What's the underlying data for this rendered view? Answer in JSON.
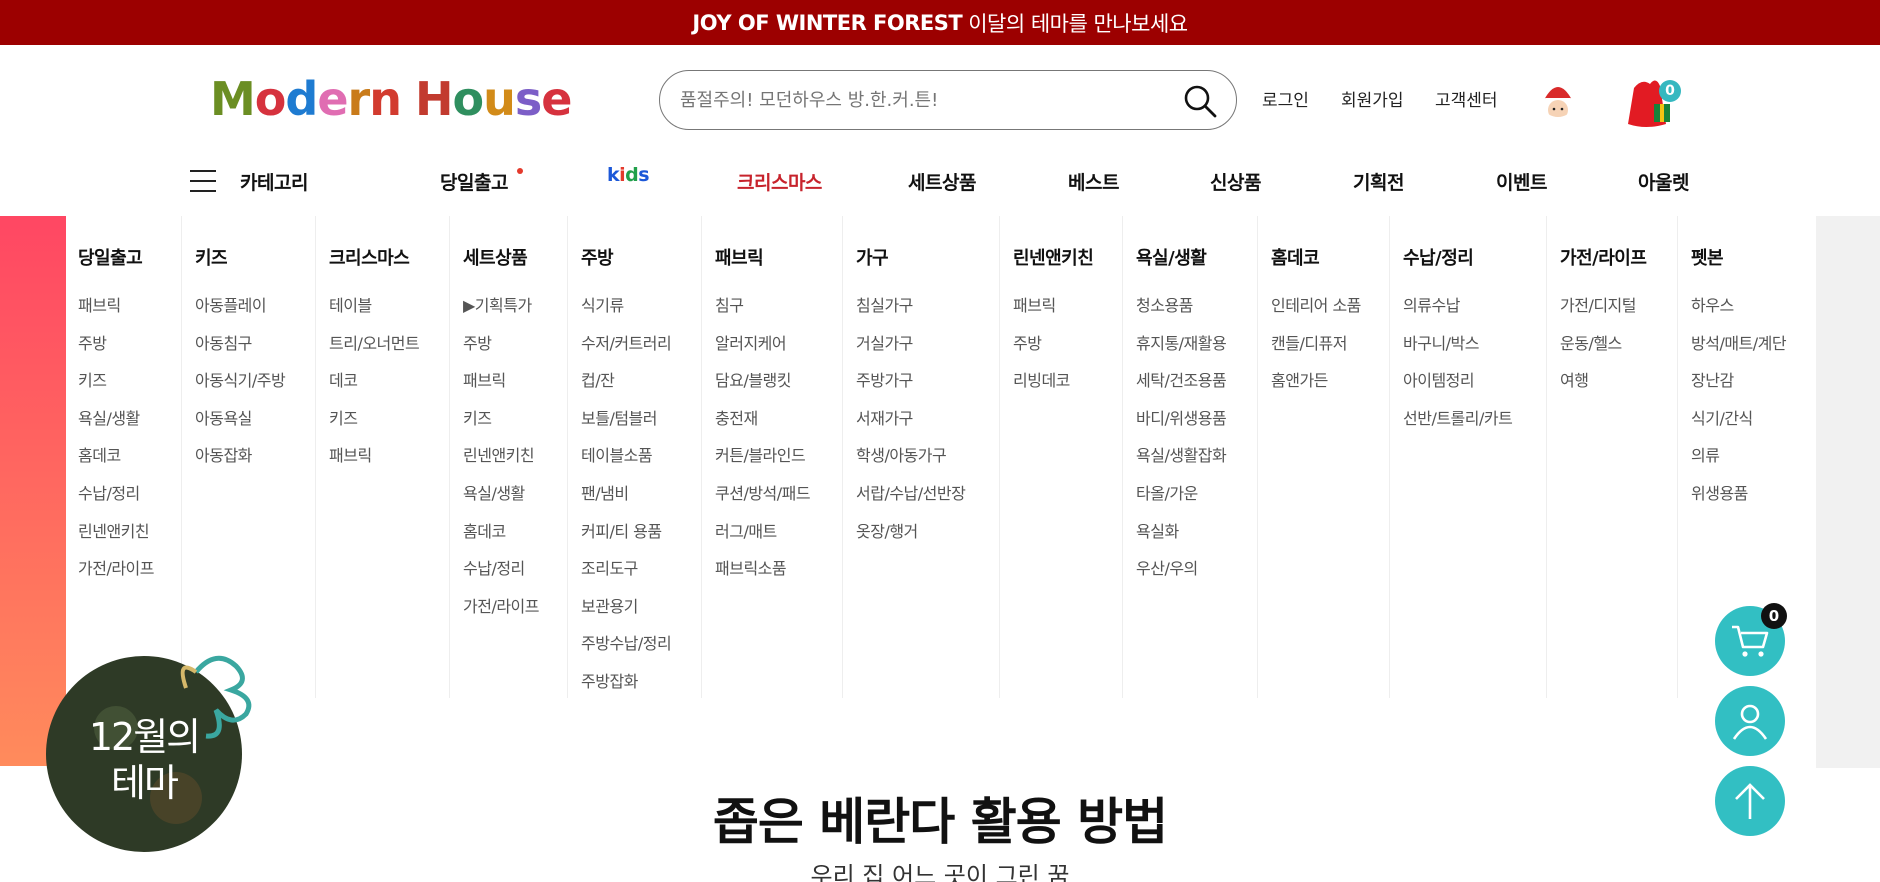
{
  "top_banner": {
    "bold": "JOY OF WINTER FOREST",
    "text": "이달의 테마를 만나보세요"
  },
  "logo": {
    "text": "ModernHouse"
  },
  "search": {
    "placeholder": "품절주의! 모던하우스 방.한.커.튼!"
  },
  "header_links": {
    "login": "로그인",
    "signup": "회원가입",
    "support": "고객센터"
  },
  "cart_count": "0",
  "nav": {
    "category": "카테고리",
    "same_day": "당일출고",
    "kids": "kids",
    "christmas": "크리스마스",
    "set": "세트상품",
    "best": "베스트",
    "new": "신상품",
    "promotion": "기획전",
    "event": "이벤트",
    "outlet": "아울렛"
  },
  "mega_menu": [
    {
      "title": "당일출고",
      "items": [
        "패브릭",
        "주방",
        "키즈",
        "욕실/생활",
        "홈데코",
        "수납/정리",
        "린넨앤키친",
        "가전/라이프"
      ]
    },
    {
      "title": "키즈",
      "items": [
        "아동플레이",
        "아동침구",
        "아동식기/주방",
        "아동욕실",
        "아동잡화"
      ]
    },
    {
      "title": "크리스마스",
      "items": [
        "테이블",
        "트리/오너먼트",
        "데코",
        "키즈",
        "패브릭"
      ]
    },
    {
      "title": "세트상품",
      "items": [
        "▶기획특가",
        "주방",
        "패브릭",
        "키즈",
        "린넨앤키친",
        "욕실/생활",
        "홈데코",
        "수납/정리",
        "가전/라이프"
      ]
    },
    {
      "title": "주방",
      "items": [
        "식기류",
        "수저/커트러리",
        "컵/잔",
        "보틀/텀블러",
        "테이블소품",
        "팬/냄비",
        "커피/티 용품",
        "조리도구",
        "보관용기",
        "주방수납/정리",
        "주방잡화"
      ]
    },
    {
      "title": "패브릭",
      "items": [
        "침구",
        "알러지케어",
        "담요/블랭킷",
        "충전재",
        "커튼/블라인드",
        "쿠션/방석/패드",
        "러그/매트",
        "패브릭소품"
      ]
    },
    {
      "title": "가구",
      "items": [
        "침실가구",
        "거실가구",
        "주방가구",
        "서재가구",
        "학생/아동가구",
        "서랍/수납/선반장",
        "옷장/행거"
      ]
    },
    {
      "title": "린넨앤키친",
      "items": [
        "패브릭",
        "주방",
        "리빙데코"
      ]
    },
    {
      "title": "욕실/생활",
      "items": [
        "청소용품",
        "휴지통/재활용",
        "세탁/건조용품",
        "바디/위생용품",
        "욕실/생활잡화",
        "타올/가운",
        "욕실화",
        "우산/우의"
      ]
    },
    {
      "title": "홈데코",
      "items": [
        "인테리어 소품",
        "캔들/디퓨저",
        "홈앤가든"
      ]
    },
    {
      "title": "수납/정리",
      "items": [
        "의류수납",
        "바구니/박스",
        "아이템정리",
        "선반/트롤리/카트"
      ]
    },
    {
      "title": "가전/라이프",
      "items": [
        "가전/디지털",
        "운동/헬스",
        "여행"
      ]
    },
    {
      "title": "펫본",
      "items": [
        "하우스",
        "방석/매트/계단",
        "장난감",
        "식기/간식",
        "의류",
        "위생용품"
      ]
    }
  ],
  "ornament": {
    "line1": "12월의",
    "line2": "테마"
  },
  "content": {
    "title": "좁은 베란다 활용 방법",
    "subtitle": "우리 집 어느 곳이 그린 꿈"
  },
  "quick": {
    "cart_count": "0"
  },
  "colors": {
    "banner": "#9c0000",
    "accent": "#32bfc3"
  }
}
